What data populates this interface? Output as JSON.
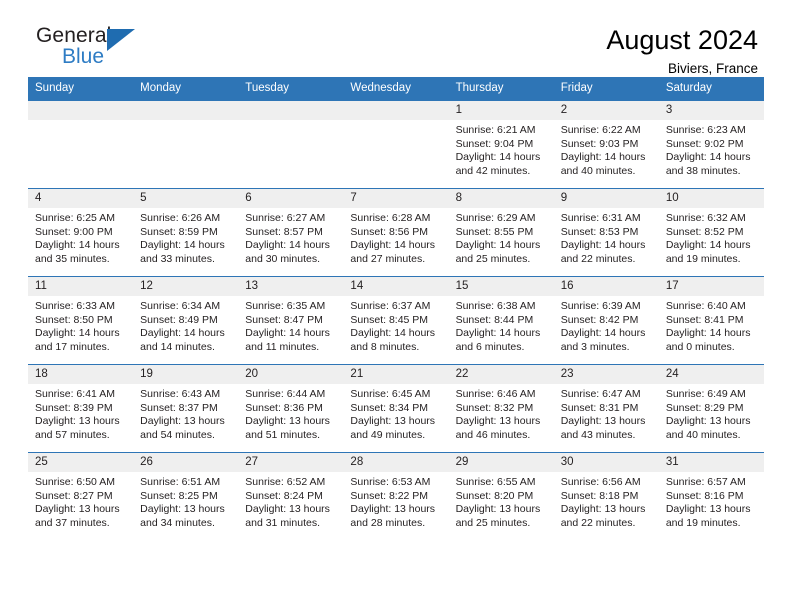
{
  "brand": {
    "name_part1": "General",
    "name_part2": "Blue",
    "triangle_color": "#1f6cb0"
  },
  "header": {
    "title": "August 2024",
    "location": "Biviers, France"
  },
  "theme": {
    "header_blue": "#2e75b6",
    "daynum_gray": "#efefef",
    "text_color": "#231f20"
  },
  "weekday_headers": [
    "Sunday",
    "Monday",
    "Tuesday",
    "Wednesday",
    "Thursday",
    "Friday",
    "Saturday"
  ],
  "weeks": [
    [
      {
        "day": "",
        "empty": true
      },
      {
        "day": "",
        "empty": true
      },
      {
        "day": "",
        "empty": true
      },
      {
        "day": "",
        "empty": true
      },
      {
        "day": "1",
        "sunrise": "Sunrise: 6:21 AM",
        "sunset": "Sunset: 9:04 PM",
        "daylight": "Daylight: 14 hours and 42 minutes."
      },
      {
        "day": "2",
        "sunrise": "Sunrise: 6:22 AM",
        "sunset": "Sunset: 9:03 PM",
        "daylight": "Daylight: 14 hours and 40 minutes."
      },
      {
        "day": "3",
        "sunrise": "Sunrise: 6:23 AM",
        "sunset": "Sunset: 9:02 PM",
        "daylight": "Daylight: 14 hours and 38 minutes."
      }
    ],
    [
      {
        "day": "4",
        "sunrise": "Sunrise: 6:25 AM",
        "sunset": "Sunset: 9:00 PM",
        "daylight": "Daylight: 14 hours and 35 minutes."
      },
      {
        "day": "5",
        "sunrise": "Sunrise: 6:26 AM",
        "sunset": "Sunset: 8:59 PM",
        "daylight": "Daylight: 14 hours and 33 minutes."
      },
      {
        "day": "6",
        "sunrise": "Sunrise: 6:27 AM",
        "sunset": "Sunset: 8:57 PM",
        "daylight": "Daylight: 14 hours and 30 minutes."
      },
      {
        "day": "7",
        "sunrise": "Sunrise: 6:28 AM",
        "sunset": "Sunset: 8:56 PM",
        "daylight": "Daylight: 14 hours and 27 minutes."
      },
      {
        "day": "8",
        "sunrise": "Sunrise: 6:29 AM",
        "sunset": "Sunset: 8:55 PM",
        "daylight": "Daylight: 14 hours and 25 minutes."
      },
      {
        "day": "9",
        "sunrise": "Sunrise: 6:31 AM",
        "sunset": "Sunset: 8:53 PM",
        "daylight": "Daylight: 14 hours and 22 minutes."
      },
      {
        "day": "10",
        "sunrise": "Sunrise: 6:32 AM",
        "sunset": "Sunset: 8:52 PM",
        "daylight": "Daylight: 14 hours and 19 minutes."
      }
    ],
    [
      {
        "day": "11",
        "sunrise": "Sunrise: 6:33 AM",
        "sunset": "Sunset: 8:50 PM",
        "daylight": "Daylight: 14 hours and 17 minutes."
      },
      {
        "day": "12",
        "sunrise": "Sunrise: 6:34 AM",
        "sunset": "Sunset: 8:49 PM",
        "daylight": "Daylight: 14 hours and 14 minutes."
      },
      {
        "day": "13",
        "sunrise": "Sunrise: 6:35 AM",
        "sunset": "Sunset: 8:47 PM",
        "daylight": "Daylight: 14 hours and 11 minutes."
      },
      {
        "day": "14",
        "sunrise": "Sunrise: 6:37 AM",
        "sunset": "Sunset: 8:45 PM",
        "daylight": "Daylight: 14 hours and 8 minutes."
      },
      {
        "day": "15",
        "sunrise": "Sunrise: 6:38 AM",
        "sunset": "Sunset: 8:44 PM",
        "daylight": "Daylight: 14 hours and 6 minutes."
      },
      {
        "day": "16",
        "sunrise": "Sunrise: 6:39 AM",
        "sunset": "Sunset: 8:42 PM",
        "daylight": "Daylight: 14 hours and 3 minutes."
      },
      {
        "day": "17",
        "sunrise": "Sunrise: 6:40 AM",
        "sunset": "Sunset: 8:41 PM",
        "daylight": "Daylight: 14 hours and 0 minutes."
      }
    ],
    [
      {
        "day": "18",
        "sunrise": "Sunrise: 6:41 AM",
        "sunset": "Sunset: 8:39 PM",
        "daylight": "Daylight: 13 hours and 57 minutes."
      },
      {
        "day": "19",
        "sunrise": "Sunrise: 6:43 AM",
        "sunset": "Sunset: 8:37 PM",
        "daylight": "Daylight: 13 hours and 54 minutes."
      },
      {
        "day": "20",
        "sunrise": "Sunrise: 6:44 AM",
        "sunset": "Sunset: 8:36 PM",
        "daylight": "Daylight: 13 hours and 51 minutes."
      },
      {
        "day": "21",
        "sunrise": "Sunrise: 6:45 AM",
        "sunset": "Sunset: 8:34 PM",
        "daylight": "Daylight: 13 hours and 49 minutes."
      },
      {
        "day": "22",
        "sunrise": "Sunrise: 6:46 AM",
        "sunset": "Sunset: 8:32 PM",
        "daylight": "Daylight: 13 hours and 46 minutes."
      },
      {
        "day": "23",
        "sunrise": "Sunrise: 6:47 AM",
        "sunset": "Sunset: 8:31 PM",
        "daylight": "Daylight: 13 hours and 43 minutes."
      },
      {
        "day": "24",
        "sunrise": "Sunrise: 6:49 AM",
        "sunset": "Sunset: 8:29 PM",
        "daylight": "Daylight: 13 hours and 40 minutes."
      }
    ],
    [
      {
        "day": "25",
        "sunrise": "Sunrise: 6:50 AM",
        "sunset": "Sunset: 8:27 PM",
        "daylight": "Daylight: 13 hours and 37 minutes."
      },
      {
        "day": "26",
        "sunrise": "Sunrise: 6:51 AM",
        "sunset": "Sunset: 8:25 PM",
        "daylight": "Daylight: 13 hours and 34 minutes."
      },
      {
        "day": "27",
        "sunrise": "Sunrise: 6:52 AM",
        "sunset": "Sunset: 8:24 PM",
        "daylight": "Daylight: 13 hours and 31 minutes."
      },
      {
        "day": "28",
        "sunrise": "Sunrise: 6:53 AM",
        "sunset": "Sunset: 8:22 PM",
        "daylight": "Daylight: 13 hours and 28 minutes."
      },
      {
        "day": "29",
        "sunrise": "Sunrise: 6:55 AM",
        "sunset": "Sunset: 8:20 PM",
        "daylight": "Daylight: 13 hours and 25 minutes."
      },
      {
        "day": "30",
        "sunrise": "Sunrise: 6:56 AM",
        "sunset": "Sunset: 8:18 PM",
        "daylight": "Daylight: 13 hours and 22 minutes."
      },
      {
        "day": "31",
        "sunrise": "Sunrise: 6:57 AM",
        "sunset": "Sunset: 8:16 PM",
        "daylight": "Daylight: 13 hours and 19 minutes."
      }
    ]
  ]
}
